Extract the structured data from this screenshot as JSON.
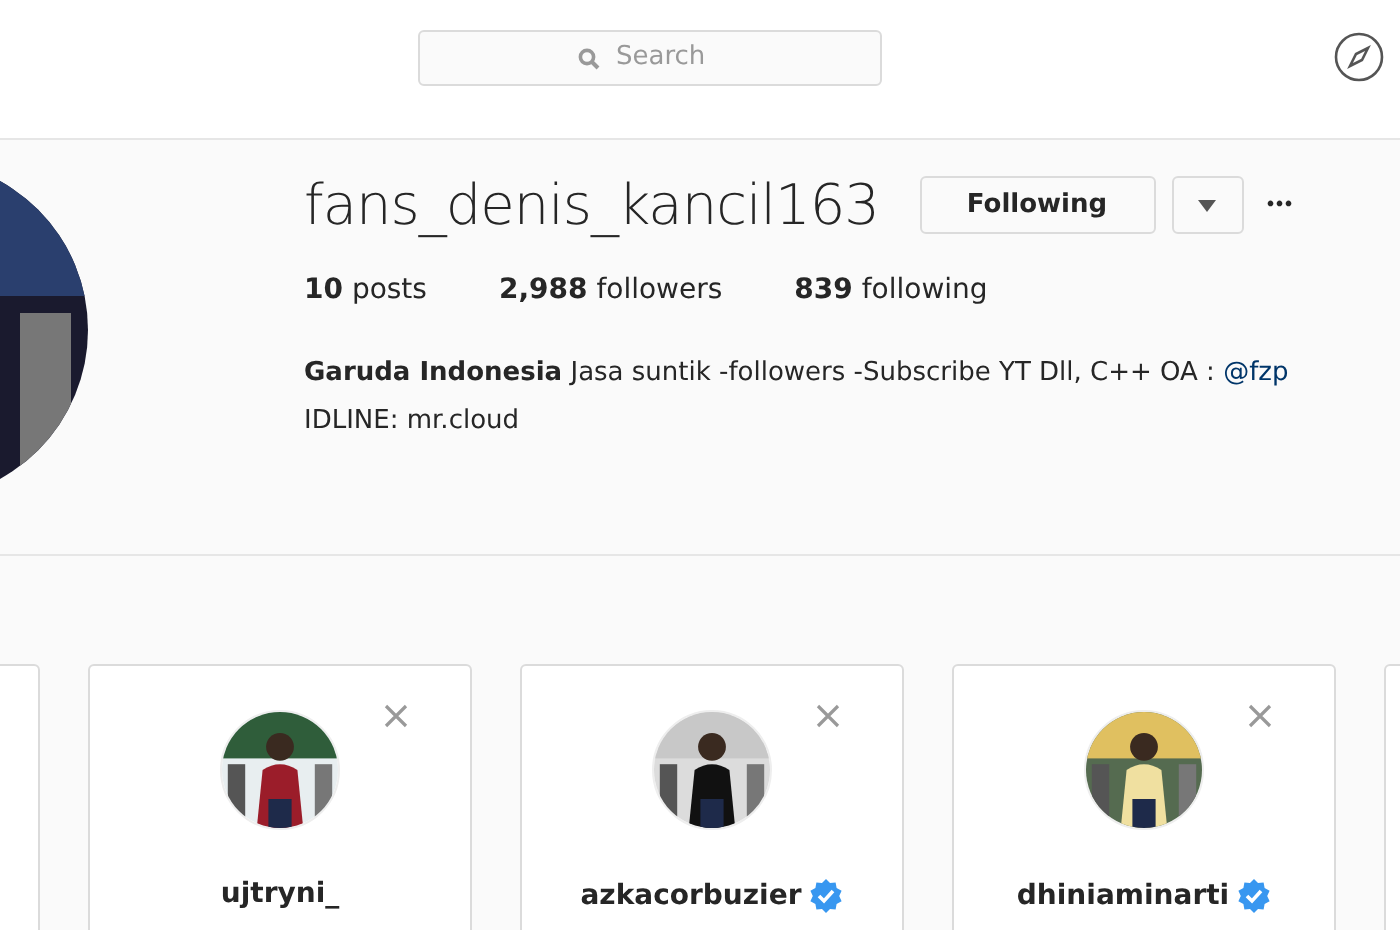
{
  "search": {
    "placeholder": "Search"
  },
  "profile": {
    "username": "fans_denis_kancil163",
    "follow_button": "Following",
    "more": "•••",
    "stats": [
      {
        "count": "10",
        "label": "posts"
      },
      {
        "count": "2,988",
        "label": "followers"
      },
      {
        "count": "839",
        "label": "following"
      }
    ],
    "bio_name": "Garuda Indonesia",
    "bio_text": "Jasa suntik -followers -Subscribe YT Dll, C++ OA : ",
    "bio_link": "@fzp",
    "bio_line2": "IDLINE: mr.cloud"
  },
  "suggestions": [
    {
      "username": "ujtryni_",
      "verified": false
    },
    {
      "username": "azkacorbuzier",
      "verified": true
    },
    {
      "username": "dhiniaminarti",
      "verified": true
    }
  ]
}
